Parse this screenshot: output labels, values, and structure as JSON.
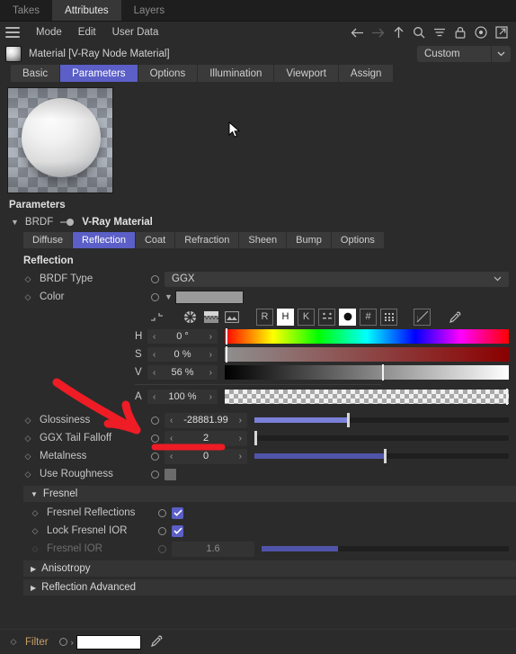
{
  "window": {
    "top_tabs": [
      {
        "label": "Takes",
        "active": false
      },
      {
        "label": "Attributes",
        "active": true
      },
      {
        "label": "Layers",
        "active": false
      }
    ],
    "menu_items": [
      "Mode",
      "Edit",
      "User Data"
    ],
    "nav_icons": [
      "back-arrow-icon",
      "forward-arrow-icon",
      "up-arrow-icon",
      "search-icon",
      "filter-icon",
      "lock-icon",
      "record-icon",
      "open-external-icon"
    ]
  },
  "material_header": {
    "title": "Material [V-Ray Node Material]",
    "thumbnail": "material-sphere-thumbnail",
    "preset_select": {
      "value": "Custom"
    }
  },
  "section_tabs": [
    {
      "label": "Basic",
      "active": false
    },
    {
      "label": "Parameters",
      "active": true
    },
    {
      "label": "Options",
      "active": false
    },
    {
      "label": "Illumination",
      "active": false
    },
    {
      "label": "Viewport",
      "active": false
    },
    {
      "label": "Assign",
      "active": false
    }
  ],
  "preview": {
    "name": "material-preview-sphere"
  },
  "parameters": {
    "title": "Parameters",
    "brdf_row": {
      "label": "BRDF",
      "value": "V-Ray Material"
    },
    "brdf_tabs": [
      {
        "label": "Diffuse",
        "active": false
      },
      {
        "label": "Reflection",
        "active": true
      },
      {
        "label": "Coat",
        "active": false
      },
      {
        "label": "Refraction",
        "active": false
      },
      {
        "label": "Sheen",
        "active": false
      },
      {
        "label": "Bump",
        "active": false
      },
      {
        "label": "Options",
        "active": false
      }
    ],
    "reflection_title": "Reflection",
    "brdf_type": {
      "label": "BRDF Type",
      "value": "GGX"
    },
    "color": {
      "label": "Color",
      "swatch_hex": "#9a9a9a"
    },
    "color_toolbar": [
      "corner-picker-icon",
      "color-wheel-icon",
      "gradient-icon",
      "image-icon",
      "rgb-mode-button",
      "hsv-mode-button",
      "kelvin-mode-button",
      "mixer-mode-button",
      "circle-mode-button",
      "hex-mode-button",
      "swatches-mode-button",
      "curve-icon",
      "eyedropper-icon"
    ],
    "color_modes": [
      {
        "label": "R",
        "active": false
      },
      {
        "label": "H",
        "active": true
      },
      {
        "label": "K",
        "active": false
      },
      {
        "label": "∶·∶",
        "active": false
      },
      {
        "label": "●",
        "active": true
      },
      {
        "label": "#",
        "active": false
      },
      {
        "label": "∷",
        "active": false
      }
    ],
    "hsv": [
      {
        "label": "H",
        "value": "0 °",
        "handle_pct": 0.4,
        "grad": "hue"
      },
      {
        "label": "S",
        "value": "0 %",
        "handle_pct": 0.4,
        "grad": "sat"
      },
      {
        "label": "V",
        "value": "56 %",
        "handle_pct": 56,
        "grad": "val"
      },
      {
        "label": "A",
        "value": "100 %",
        "handle_pct": 99.4,
        "grad": "alpha"
      }
    ],
    "sliders": [
      {
        "label": "Glossiness",
        "value": "-28881.99",
        "fill_pct": 36.5,
        "handle_pct": 36.5,
        "highlighted": true
      },
      {
        "label": "GGX Tail Falloff",
        "value": "2",
        "fill_pct": 0.4,
        "handle_pct": 0.4,
        "highlighted": false
      },
      {
        "label": "Metalness",
        "value": "0",
        "fill_pct": 51,
        "handle_pct": 51,
        "highlighted": false
      }
    ],
    "use_roughness": {
      "label": "Use Roughness",
      "checked": false
    },
    "fresnel": {
      "group_label": "Fresnel",
      "expanded": true,
      "rows": [
        {
          "label": "Fresnel Reflections",
          "checked": true,
          "type": "checkbox",
          "disabled": false
        },
        {
          "label": "Lock Fresnel IOR",
          "checked": true,
          "type": "checkbox",
          "disabled": false
        },
        {
          "label": "Fresnel IOR",
          "value": "1.6",
          "type": "number",
          "disabled": true,
          "fill_pct": 31
        }
      ]
    },
    "collapsed_groups": [
      {
        "label": "Anisotropy"
      },
      {
        "label": "Reflection Advanced"
      }
    ]
  },
  "filter_bar": {
    "label": "Filter",
    "input_value": "",
    "eyedropper": "eyedropper-icon"
  },
  "annotation": {
    "type": "red-arrow-and-underline",
    "color": "#ee1c25",
    "points_at": "Glossiness value field"
  },
  "colors": {
    "accent": "#5b5fc7",
    "slider_fill": "#7b80d8",
    "panel_bg": "#2b2b2b",
    "annotation_red": "#ee1c25"
  }
}
